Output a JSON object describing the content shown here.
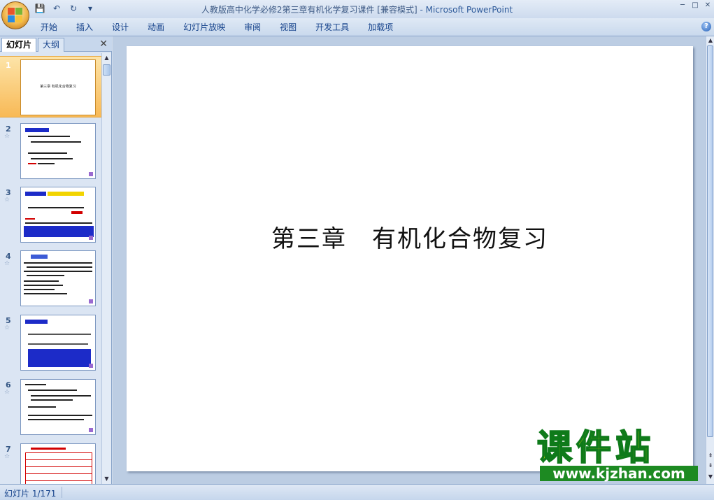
{
  "window": {
    "title": "人教版高中化学必修2第三章有机化学复习课件 [兼容模式]",
    "app_name": " - Microsoft PowerPoint",
    "controls": [
      "─",
      "□",
      "✕"
    ]
  },
  "quick_access": {
    "save": "💾",
    "undo": "↶",
    "repeat": "↻",
    "customize": "▾"
  },
  "ribbon": {
    "tabs": [
      "开始",
      "插入",
      "设计",
      "动画",
      "幻灯片放映",
      "审阅",
      "视图",
      "开发工具",
      "加载项"
    ],
    "help": "?"
  },
  "panel": {
    "tab_slides": "幻灯片",
    "tab_outline": "大纲",
    "close": "✕"
  },
  "slides": [
    {
      "num": "1",
      "selected": true,
      "title": "第三章 有机化合物复习"
    },
    {
      "num": "2",
      "star": "☆"
    },
    {
      "num": "3",
      "star": "☆"
    },
    {
      "num": "4",
      "star": "☆"
    },
    {
      "num": "5",
      "star": "☆"
    },
    {
      "num": "6",
      "star": "☆"
    },
    {
      "num": "7",
      "star": "☆"
    }
  ],
  "main_slide": {
    "title": "第三章　有机化合物复习"
  },
  "watermark": {
    "text": "课件站",
    "url": "www.kjzhan.com"
  },
  "status": {
    "slide_position": "幻灯片 1/171"
  },
  "colors": {
    "accent": "#15428b",
    "selected_thumb": "#f8b956"
  }
}
